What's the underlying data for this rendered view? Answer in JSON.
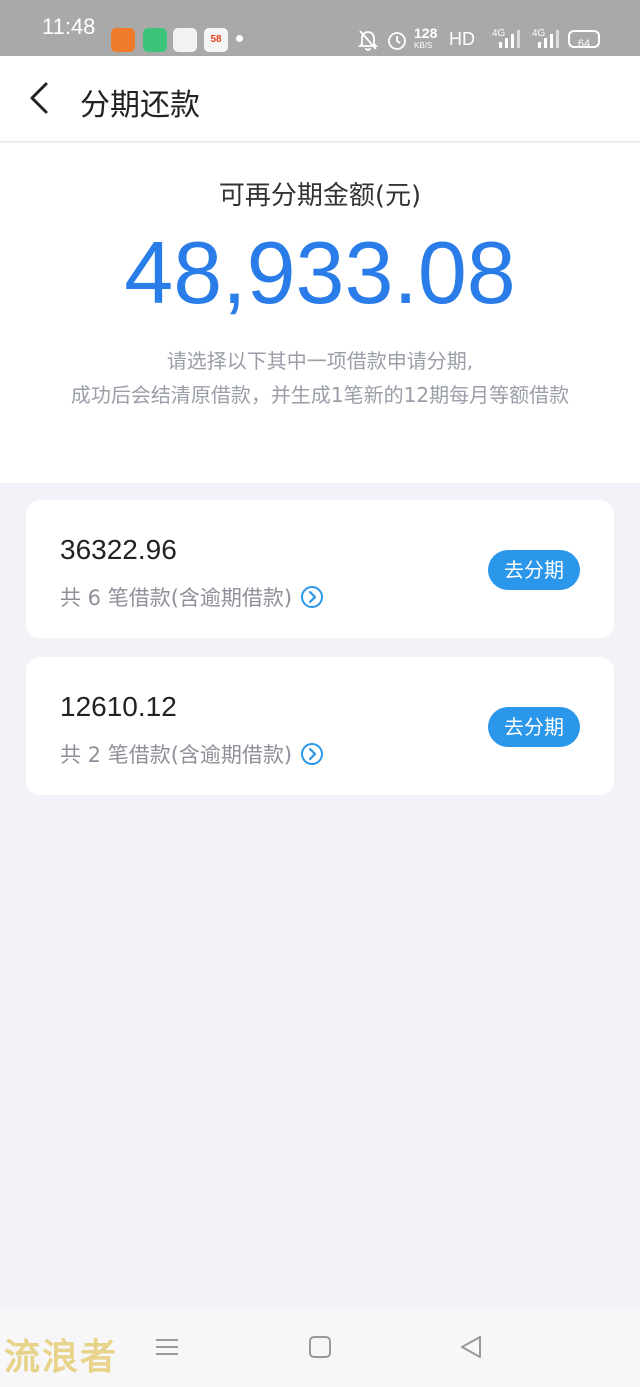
{
  "status_bar": {
    "time": "11:48",
    "app_icons": [
      "",
      "",
      "",
      "58"
    ],
    "net_speed": "128",
    "net_unit": "KB/S",
    "hd": "HD",
    "signal1": "4G",
    "signal2": "4G",
    "battery": "64"
  },
  "header": {
    "title": "分期还款"
  },
  "summary": {
    "label": "可再分期金额(元)",
    "amount": "48,933.08",
    "desc_line1": "请选择以下其中一项借款申请分期,",
    "desc_line2": "成功后会结清原借款，并生成1笔新的12期每月等额借款"
  },
  "loans": [
    {
      "amount": "36322.96",
      "desc": "共 6 笔借款(含逾期借款)",
      "button": "去分期"
    },
    {
      "amount": "12610.12",
      "desc": "共 2 笔借款(含逾期借款)",
      "button": "去分期"
    }
  ],
  "watermark": "流浪者",
  "colors": {
    "accent": "#2a7de8",
    "button": "#2a97ea",
    "background": "#f2f3f8"
  }
}
